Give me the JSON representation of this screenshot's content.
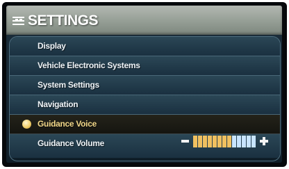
{
  "header": {
    "title": "SETTINGS",
    "icon": "settings-menu-icon"
  },
  "menu": {
    "items": [
      {
        "label": "Display",
        "selected": false
      },
      {
        "label": "Vehicle Electronic Systems",
        "selected": false
      },
      {
        "label": "System Settings",
        "selected": false
      },
      {
        "label": "Navigation",
        "selected": false
      },
      {
        "label": "Guidance Voice",
        "selected": true
      },
      {
        "label": "Guidance Volume",
        "selected": false
      }
    ]
  },
  "volume": {
    "level": 0.6,
    "minus_icon": "minus-icon",
    "plus_icon": "plus-icon",
    "filled_color": "#f0c060",
    "empty_color": "#c8e4ff"
  },
  "colors": {
    "title_bar": "#9aa39a",
    "menu_background": "#1f3847",
    "selected_text": "#f2d889",
    "selected_bullet": "#f0cf6d"
  }
}
